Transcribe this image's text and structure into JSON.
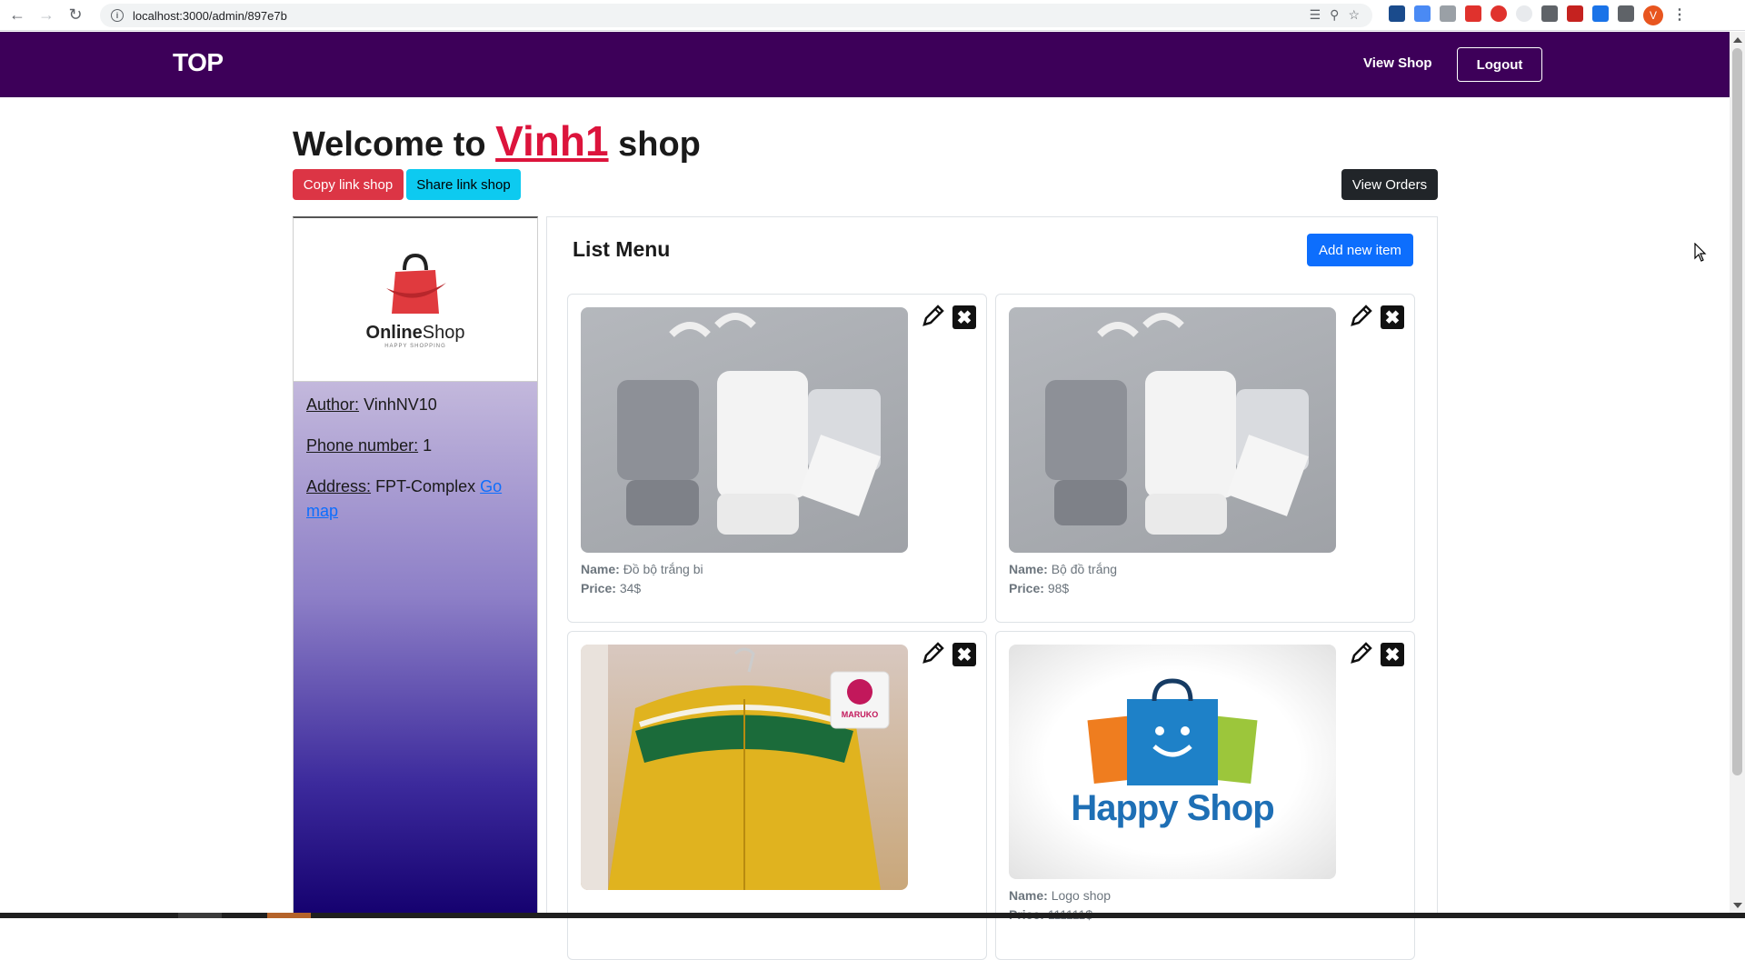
{
  "browser": {
    "url": "localhost:3000/admin/897e7b",
    "profile_initial": "V"
  },
  "navbar": {
    "brand": "TOP",
    "view_shop": "View Shop",
    "logout": "Logout",
    "bg_color": "#3d0059"
  },
  "header": {
    "welcome_prefix": "Welcome to",
    "shop_name": "Vinh1",
    "welcome_suffix": "shop",
    "copy_link": "Copy link shop",
    "share_link": "Share link shop",
    "view_orders": "View Orders"
  },
  "sidebar": {
    "logo_name_bold": "Online",
    "logo_name_rest": "Shop",
    "logo_tagline": "HAPPY SHOPPING",
    "author_label": "Author:",
    "author_value": "VinhNV10",
    "phone_label": "Phone number:",
    "phone_value": "1",
    "address_label": "Address:",
    "address_value": "FPT-Complex",
    "go_map": "Go map"
  },
  "menu": {
    "title": "List Menu",
    "add_button": "Add new item",
    "name_label": "Name:",
    "price_label": "Price:",
    "items": [
      {
        "name": "Đồ bộ trắng bi",
        "price": "34$",
        "image": "white-clothes-set"
      },
      {
        "name": "Bộ đồ trắng",
        "price": "98$",
        "image": "white-clothes-set"
      },
      {
        "name": "",
        "price": "",
        "image": "yellow-cardigan",
        "badge": "MARUKO"
      },
      {
        "name": "Logo shop",
        "price": "111111$",
        "image": "happy-shop-logo",
        "logo_text": "Happy Shop"
      }
    ]
  }
}
